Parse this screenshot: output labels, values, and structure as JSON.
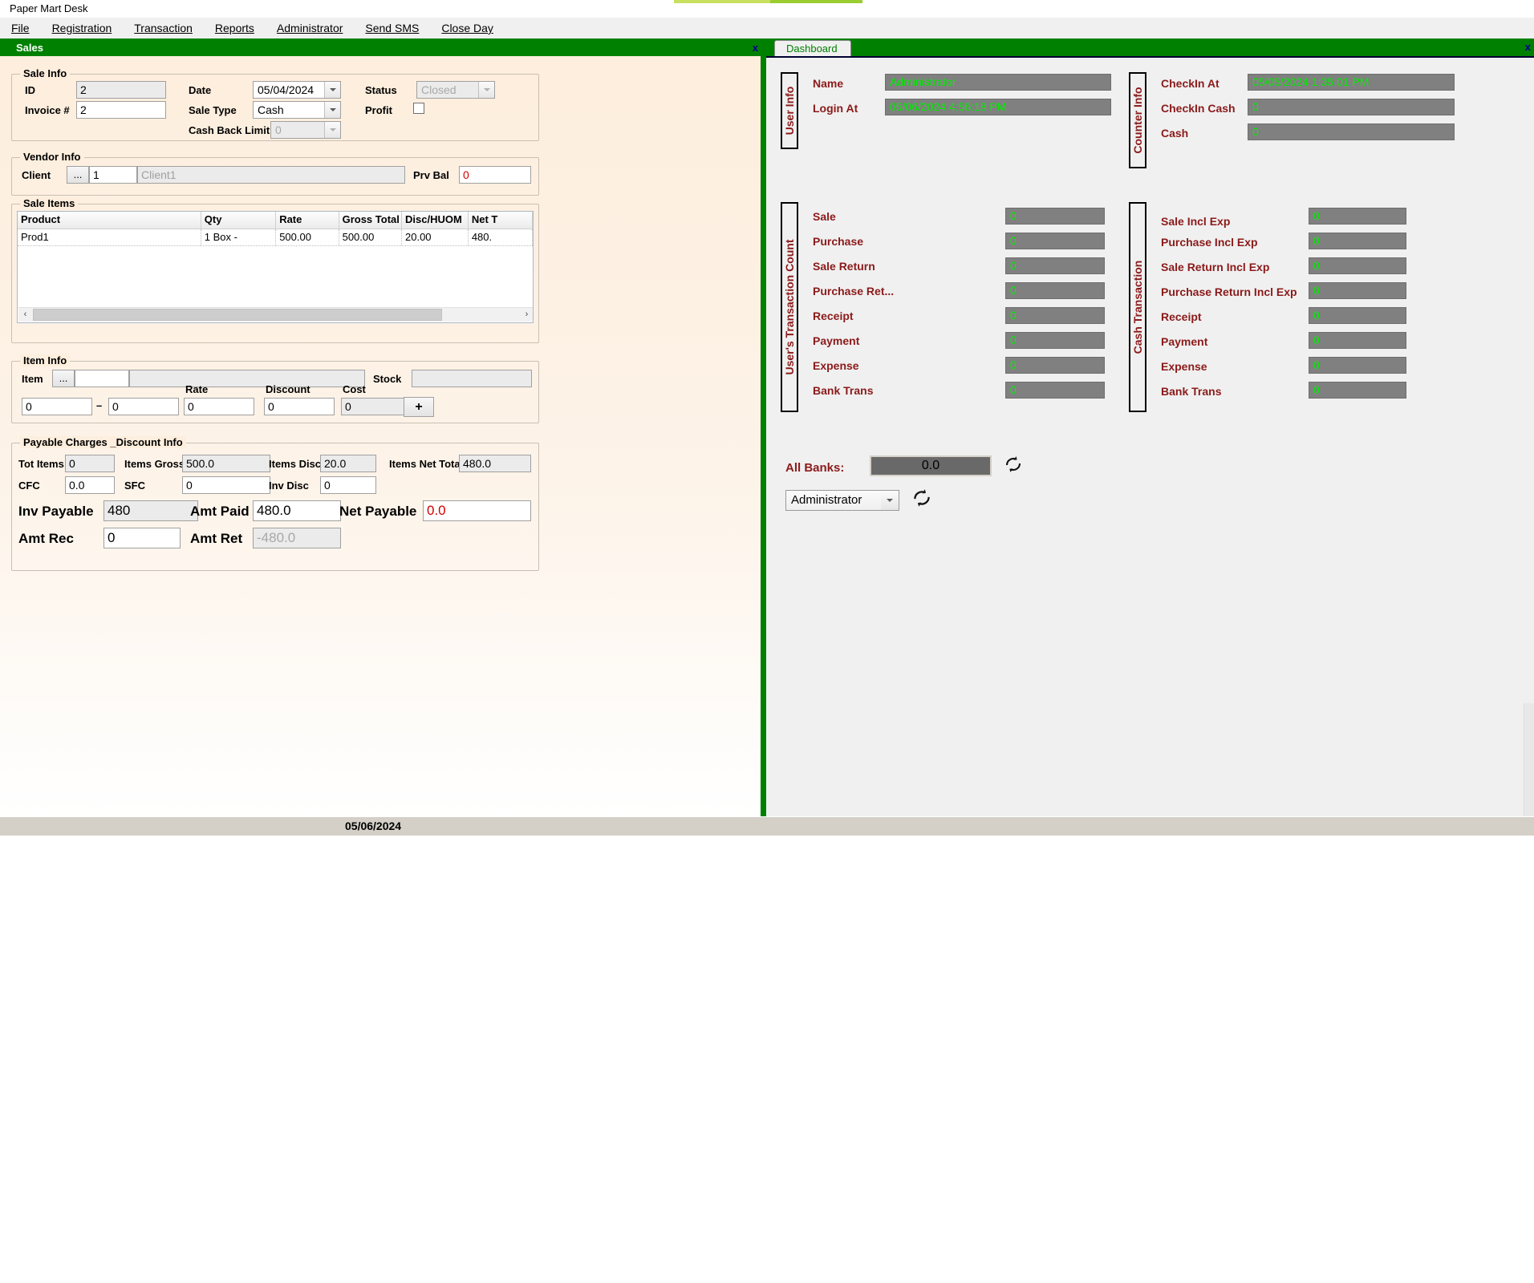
{
  "app": {
    "title": "Paper Mart Desk",
    "menu": [
      "File",
      "Registration",
      "Transaction",
      "Reports",
      "Administrator",
      "Send SMS",
      "Close Day"
    ]
  },
  "sales_window": {
    "caption": "Sales",
    "close_label": "x",
    "sale_info": {
      "legend": "Sale Info",
      "id_label": "ID",
      "id_value": "2",
      "invoice_label": "Invoice #",
      "invoice_value": "2",
      "date_label": "Date",
      "date_value": "05/04/2024",
      "sale_type_label": "Sale Type",
      "sale_type_value": "Cash",
      "cash_back_limit_label": "Cash Back Limit",
      "cash_back_limit_value": "0",
      "status_label": "Status",
      "status_value": "Closed",
      "profit_label": "Profit"
    },
    "vendor_info": {
      "legend": "Vendor Info",
      "client_label": "Client",
      "browse_label": "...",
      "client_id": "1",
      "client_name_placeholder": "Client1",
      "prv_bal_label": "Prv Bal",
      "prv_bal_value": "0"
    },
    "sale_items": {
      "legend": "Sale Items",
      "columns": [
        "Product",
        "Qty",
        "Rate",
        "Gross Total",
        "Disc/HUOM",
        "Net T"
      ],
      "rows": [
        [
          "Prod1",
          "1 Box -",
          "500.00",
          "500.00",
          "20.00",
          "480."
        ]
      ],
      "scroll_left": "‹",
      "scroll_right": "›"
    },
    "item_info": {
      "legend": "Item Info",
      "item_label": "Item",
      "browse_label": "...",
      "item_code": "",
      "item_name": "",
      "stock_label": "Stock",
      "stock_value": "",
      "qty1": "0",
      "dash": "–",
      "qty2": "0",
      "rate_label": "Rate",
      "rate_value": "0",
      "discount_label": "Discount",
      "discount_value": "0",
      "cost_label": "Cost",
      "cost_value": "0",
      "add_label": "+"
    },
    "payable": {
      "legend": "Payable Charges _Discount Info",
      "tot_items_label": "Tot Items",
      "tot_items_value": "0",
      "items_gross_label": "Items Gross",
      "items_gross_value": "500.0",
      "items_disc_label": "Items Disc",
      "items_disc_value": "20.0",
      "items_net_total_label": "Items Net Total",
      "items_net_total_value": "480.0",
      "cfc_label": "CFC",
      "cfc_value": "0.0",
      "sfc_label": "SFC",
      "sfc_value": "0",
      "inv_disc_label": "Inv Disc",
      "inv_disc_value": "0",
      "inv_payable_label": "Inv Payable",
      "inv_payable_value": "480",
      "amt_paid_label": "Amt Paid",
      "amt_paid_value": "480.0",
      "net_payable_label": "Net Payable",
      "net_payable_value": "0.0",
      "amt_rec_label": "Amt Rec",
      "amt_rec_value": "0",
      "amt_ret_label": "Amt Ret",
      "amt_ret_value": "-480.0"
    }
  },
  "dashboard": {
    "tab_label": "Dashboard",
    "close_label": "x",
    "user_info": {
      "legend": "User Info",
      "rows": [
        {
          "label": "Name",
          "value": "Administrator"
        },
        {
          "label": "Login At",
          "value": "05/06/2024 4:56:18 PM"
        }
      ]
    },
    "counter_info": {
      "legend": "Counter Info",
      "rows": [
        {
          "label": "CheckIn At",
          "value": "05/05/2024 1:35:01 PM"
        },
        {
          "label": "CheckIn Cash",
          "value": "0"
        },
        {
          "label": "Cash",
          "value": "0"
        }
      ]
    },
    "user_transaction_count": {
      "legend": "User's Transaction Count",
      "rows": [
        {
          "label": "Sale",
          "value": "0"
        },
        {
          "label": "Purchase",
          "value": "0"
        },
        {
          "label": "Sale Return",
          "value": "0"
        },
        {
          "label": "Purchase Ret...",
          "value": "0"
        },
        {
          "label": "Receipt",
          "value": "0"
        },
        {
          "label": "Payment",
          "value": "0"
        },
        {
          "label": "Expense",
          "value": "0"
        },
        {
          "label": "Bank Trans",
          "value": "0"
        }
      ]
    },
    "cash_transaction": {
      "legend": "Cash Transaction",
      "rows": [
        {
          "label": "Sale Incl Exp",
          "value": "0"
        },
        {
          "label": "Purchase Incl Exp",
          "value": "0"
        },
        {
          "label": "Sale Return Incl Exp",
          "value": "0"
        },
        {
          "label": "Purchase Return Incl Exp",
          "value": "0"
        },
        {
          "label": "Receipt",
          "value": "0"
        },
        {
          "label": "Payment",
          "value": "0"
        },
        {
          "label": "Expense",
          "value": "0"
        },
        {
          "label": "Bank Trans",
          "value": "0"
        }
      ]
    },
    "all_banks_label": "All Banks:",
    "all_banks_value": "0.0",
    "user_select_value": "Administrator"
  },
  "status_bar": {
    "date": "05/06/2024"
  },
  "colors": {
    "green_chrome": "#008000",
    "label_maroon": "#8b1a1a",
    "value_green": "#00ee00",
    "value_bg": "#808080",
    "form_bg": "#fdeedd",
    "alert_red": "#d00000"
  }
}
